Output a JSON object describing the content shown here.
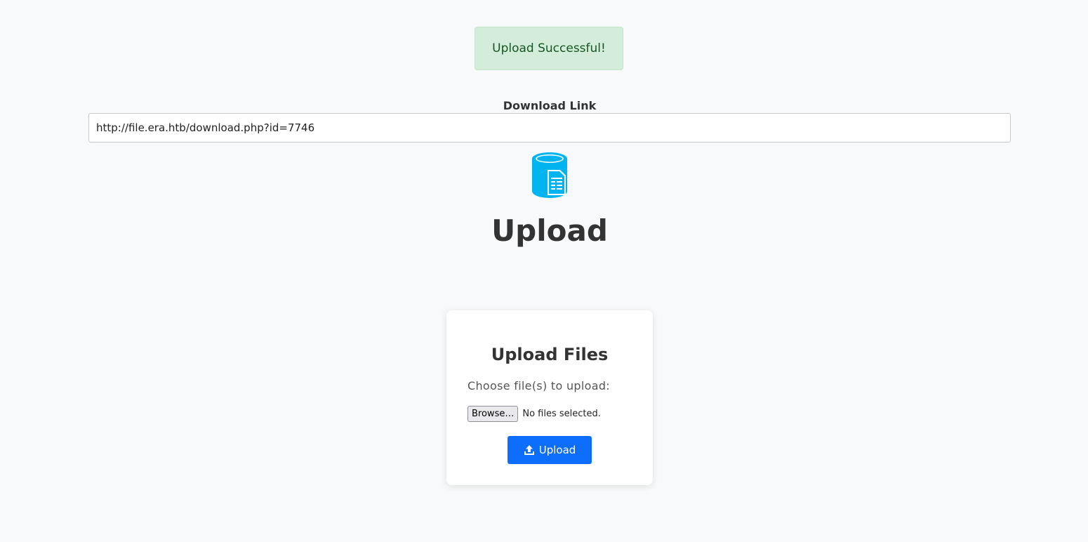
{
  "alert": {
    "message": "Upload Successful!",
    "bg_color": "#d4edda",
    "text_color": "#155724"
  },
  "download": {
    "label": "Download Link",
    "url": "http://file.era.htb/download.php?id=7746"
  },
  "logo": {
    "icon": "database-document-icon",
    "color": "#00b4f0"
  },
  "page_title": "Upload",
  "card": {
    "title": "Upload Files",
    "choose_label": "Choose file(s) to upload:",
    "browse_label": "Browse…",
    "no_files_text": "No files selected.",
    "upload_button_label": "Upload",
    "upload_icon": "upload-icon",
    "button_color": "#0d6efd"
  }
}
